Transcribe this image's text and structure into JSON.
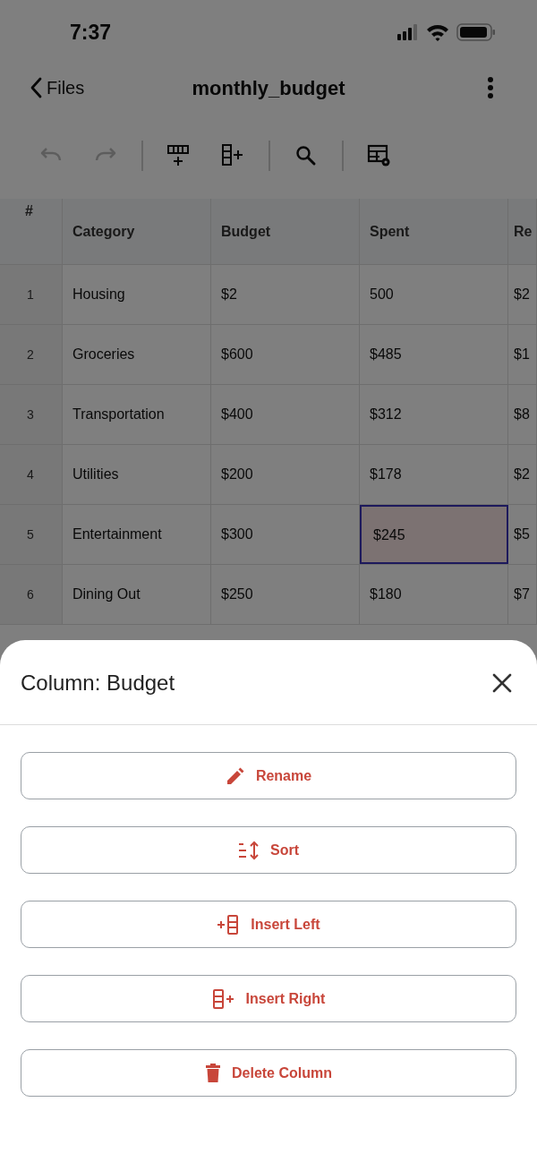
{
  "status_bar": {
    "time": "7:37"
  },
  "nav": {
    "back_label": "Files",
    "title": "monthly_budget"
  },
  "toolbar": [
    {
      "kind": "undo",
      "disabled": true
    },
    {
      "kind": "redo",
      "disabled": true
    },
    {
      "kind": "divider"
    },
    {
      "kind": "insert_row",
      "disabled": false
    },
    {
      "kind": "insert_column",
      "disabled": false
    },
    {
      "kind": "divider"
    },
    {
      "kind": "search",
      "disabled": false
    },
    {
      "kind": "divider"
    },
    {
      "kind": "table_settings",
      "disabled": false
    }
  ],
  "table": {
    "corner": "#",
    "columns": [
      "Category",
      "Budget",
      "Spent",
      "Re"
    ],
    "rows": [
      {
        "number": "1",
        "cells": [
          {
            "text": "Housing",
            "selected": false
          },
          {
            "text": "$2",
            "selected": false
          },
          {
            "text": "500",
            "selected": false
          },
          {
            "text": "$2",
            "selected": false
          }
        ]
      },
      {
        "number": "2",
        "cells": [
          {
            "text": "Groceries",
            "selected": false
          },
          {
            "text": "$600",
            "selected": false
          },
          {
            "text": "$485",
            "selected": false
          },
          {
            "text": "$1",
            "selected": false
          }
        ]
      },
      {
        "number": "3",
        "cells": [
          {
            "text": "Transportation",
            "selected": false
          },
          {
            "text": "$400",
            "selected": false
          },
          {
            "text": "$312",
            "selected": false
          },
          {
            "text": "$8",
            "selected": false
          }
        ]
      },
      {
        "number": "4",
        "cells": [
          {
            "text": "Utilities",
            "selected": false
          },
          {
            "text": "$200",
            "selected": false
          },
          {
            "text": "$178",
            "selected": false
          },
          {
            "text": "$2",
            "selected": false
          }
        ]
      },
      {
        "number": "5",
        "cells": [
          {
            "text": "Entertainment",
            "selected": false
          },
          {
            "text": "$300",
            "selected": false
          },
          {
            "text": "$245",
            "selected": true
          },
          {
            "text": "$5",
            "selected": false
          }
        ]
      },
      {
        "number": "6",
        "cells": [
          {
            "text": "Dining Out",
            "selected": false
          },
          {
            "text": "$250",
            "selected": false
          },
          {
            "text": "$180",
            "selected": false
          },
          {
            "text": "$7",
            "selected": false
          }
        ]
      }
    ]
  },
  "sheet": {
    "title": "Column: Budget",
    "actions": [
      {
        "kind": "rename",
        "label": "Rename"
      },
      {
        "kind": "sort",
        "label": "Sort"
      },
      {
        "kind": "insert_left",
        "label": "Insert Left"
      },
      {
        "kind": "insert_right",
        "label": "Insert Right"
      },
      {
        "kind": "delete",
        "label": "Delete Column"
      }
    ]
  }
}
